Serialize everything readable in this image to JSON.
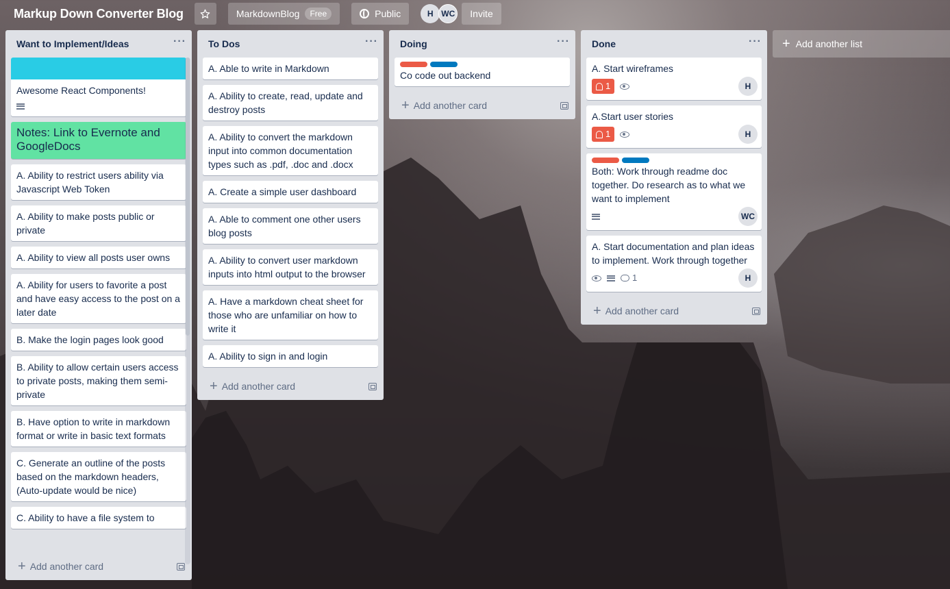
{
  "header": {
    "board_title": "Markup Down Converter Blog",
    "team_name": "MarkdownBlog",
    "team_plan": "Free",
    "visibility": "Public",
    "members": [
      "H",
      "WC"
    ],
    "invite_label": "Invite"
  },
  "lists": [
    {
      "title": "Want to Implement/Ideas",
      "cards": [
        {
          "text": "Awesome React Components!",
          "cover": "#29cce5",
          "has_description": true
        },
        {
          "text": "Notes: Link to Evernote and GoogleDocs",
          "color": "#61e2a3"
        },
        {
          "text": "A. Ability to restrict users ability via Javascript Web Token"
        },
        {
          "text": "A. Ability to make posts public or private"
        },
        {
          "text": "A. Ability to view all posts user owns"
        },
        {
          "text": "A. Ability for users to favorite a post and have easy access to the post on a later date"
        },
        {
          "text": "B. Make the login pages look good"
        },
        {
          "text": "B. Ability to allow certain users access to private posts, making them semi-private"
        },
        {
          "text": "B. Have option to write in markdown format or write in basic text formats"
        },
        {
          "text": "C. Generate an outline of the posts based on the markdown headers, (Auto-update would be nice)"
        },
        {
          "text": "C. Ability to have a file system to"
        }
      ]
    },
    {
      "title": "To Dos",
      "cards": [
        {
          "text": "A. Able to write in Markdown"
        },
        {
          "text": "A. Ability to create, read, update and destroy posts"
        },
        {
          "text": "A. Ability to convert the markdown input into common documentation types such as .pdf, .doc and .docx"
        },
        {
          "text": "A. Create a simple user dashboard"
        },
        {
          "text": "A. Able to comment one other users blog posts"
        },
        {
          "text": "A. Ability to convert user markdown inputs into html output to the browser"
        },
        {
          "text": "A. Have a markdown cheat sheet for those who are unfamiliar on how to write it"
        },
        {
          "text": "A. Ability to sign in and login"
        }
      ]
    },
    {
      "title": "Doing",
      "cards": [
        {
          "text": "Co code out backend",
          "labels": [
            "#eb5a46",
            "#0079bf"
          ]
        }
      ]
    },
    {
      "title": "Done",
      "cards": [
        {
          "text": "A. Start wireframes",
          "due": "1",
          "watch": true,
          "member": "H"
        },
        {
          "text": "A.Start user stories",
          "due": "1",
          "watch": true,
          "member": "H"
        },
        {
          "text": "Both: Work through readme doc together. Do research as to what we want to implement",
          "labels": [
            "#eb5a46",
            "#0079bf"
          ],
          "has_description": true,
          "member": "WC"
        },
        {
          "text": "A. Start documentation and plan ideas to implement. Work through together",
          "watch": true,
          "has_description": true,
          "comments": "1",
          "member": "H"
        }
      ]
    }
  ],
  "add_card_label": "Add another card",
  "add_list_label": "Add another list",
  "colors": {
    "cover": "#29cce5",
    "green_card": "#61e2a3",
    "label_red": "#eb5a46",
    "label_blue": "#0079bf",
    "list_bg": "#dfe1e6"
  },
  "icons": [
    "star-icon",
    "globe-icon",
    "more-icon",
    "plus-icon",
    "template-icon",
    "bell-icon",
    "eye-icon",
    "description-icon",
    "comment-icon"
  ]
}
